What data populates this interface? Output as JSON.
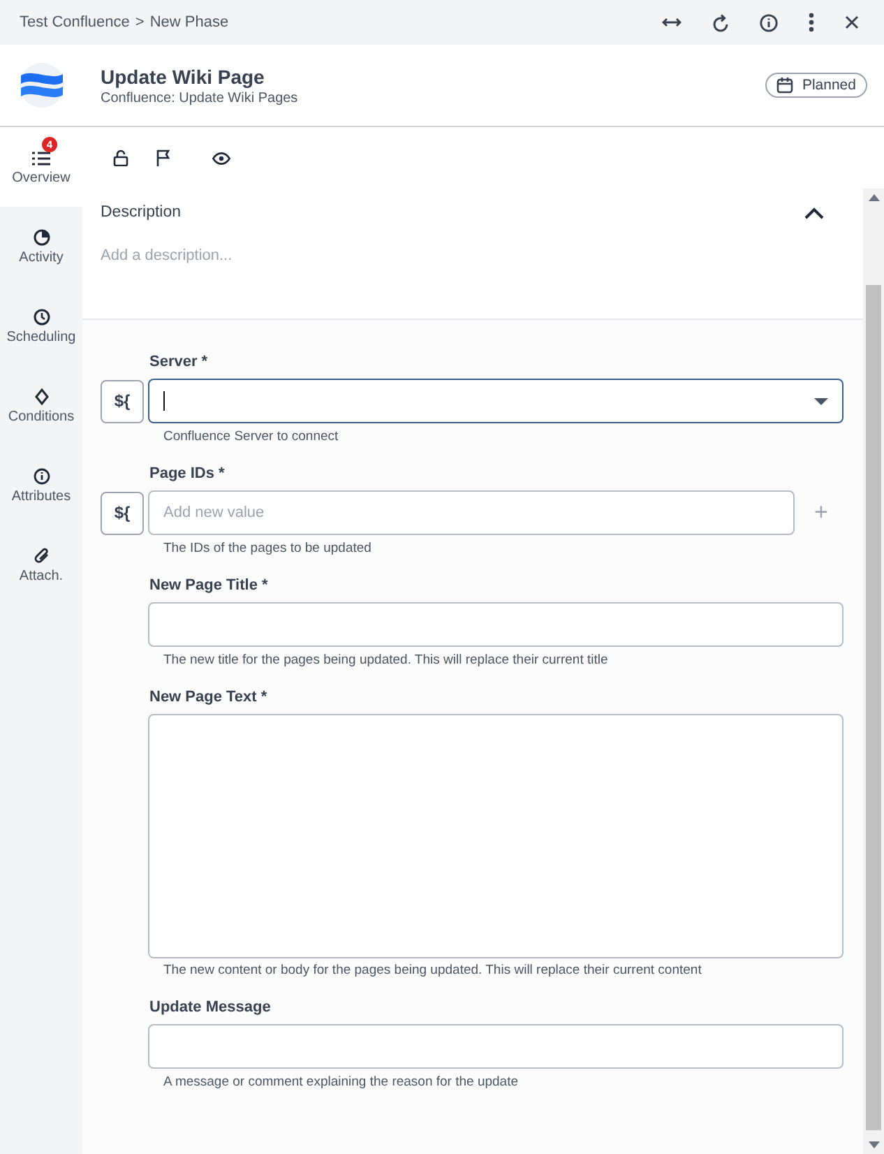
{
  "breadcrumb": {
    "parent": "Test Confluence",
    "separator": ">",
    "current": "New Phase"
  },
  "header": {
    "title": "Update Wiki Page",
    "subtitle": "Confluence: Update Wiki Pages",
    "status": "Planned"
  },
  "sidebar": {
    "items": [
      {
        "label": "Overview",
        "kind": "overview",
        "badge": "4",
        "selected": true
      },
      {
        "label": "Activity",
        "kind": "activity",
        "selected": false
      },
      {
        "label": "Scheduling",
        "kind": "scheduling",
        "selected": false
      },
      {
        "label": "Conditions",
        "kind": "conditions",
        "selected": false
      },
      {
        "label": "Attributes",
        "kind": "attributes",
        "selected": false
      },
      {
        "label": "Attach.",
        "kind": "attachments",
        "selected": false
      }
    ]
  },
  "description": {
    "title": "Description",
    "placeholder": "Add a description...",
    "expanded": true
  },
  "fields": [
    {
      "kind": "select",
      "label": "Server *",
      "expression": "${",
      "focused": true,
      "hint": "Confluence Server to connect"
    },
    {
      "kind": "multi",
      "label": "Page IDs *",
      "expression": "${",
      "placeholder": "Add new value",
      "add": "+",
      "focused": false,
      "hint": "The IDs of the pages to be updated"
    },
    {
      "kind": "text",
      "label": "New Page Title *",
      "focused": false,
      "hint": "The new title for the pages being updated. This will replace their current title"
    },
    {
      "kind": "textarea",
      "label": "New Page Text *",
      "focused": false,
      "hint": "The new content or body for the pages being updated. This will replace their current content"
    },
    {
      "kind": "text",
      "label": "Update Message",
      "focused": false,
      "hint": "A message or comment explaining the reason for the update"
    }
  ]
}
